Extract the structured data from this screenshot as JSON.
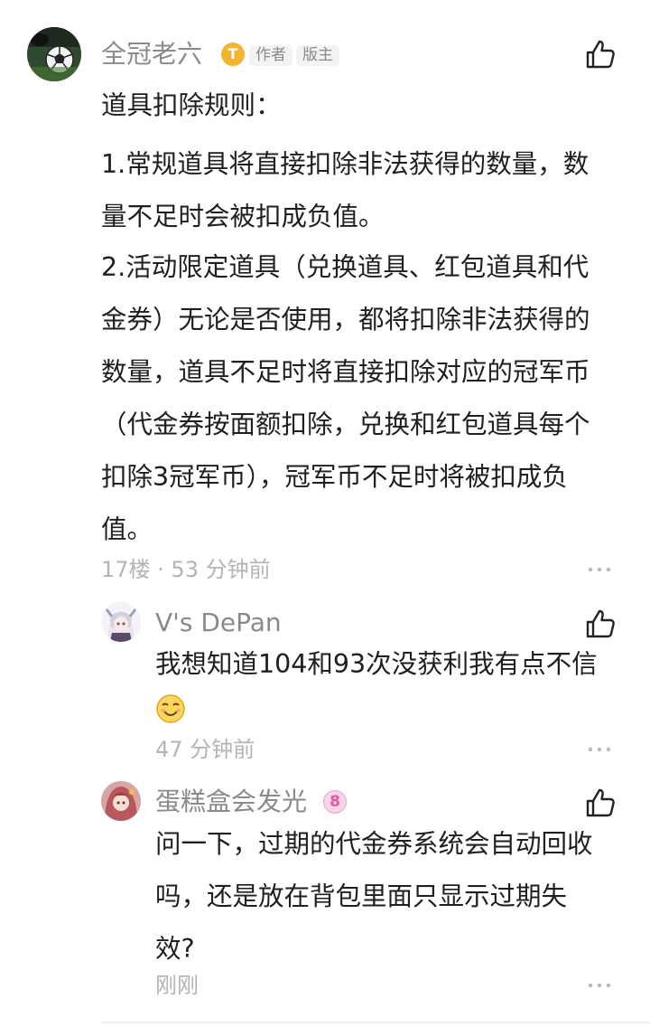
{
  "comments": [
    {
      "username": "全冠老六",
      "badge_letter": "T",
      "tags": [
        "作者",
        "版主"
      ],
      "lines": [
        "道具扣除规则：",
        "1.常规道具将直接扣除非法获得的数量，数",
        "量不足时会被扣成负值。",
        "2.活动限定道具（兑换道具、红包道具和代",
        "金券）无论是否使用，都将扣除非法获得的",
        "数量，道具不足时将直接扣除对应的冠军币",
        "（代金券按面额扣除，兑换和红包道具每个",
        "扣除3冠军币），冠军币不足时将被扣成负",
        "值。"
      ],
      "meta": "17楼 · 53 分钟前",
      "avatar_icon": "soccer-ball-icon"
    }
  ],
  "replies": [
    {
      "username": "V's DePan",
      "text": "我想知道104和93次没获利我有点不信",
      "emoji": "smiling-face-icon",
      "meta": "47 分钟前",
      "avatar_icon": "anime-avatar-icon"
    },
    {
      "username": "蛋糕盒会发光",
      "level": "8",
      "lines": [
        "问一下，过期的代金券系统会自动回收",
        "吗，还是放在背包里面只显示过期失",
        "效?"
      ],
      "meta": "刚刚",
      "avatar_icon": "anime-avatar-icon"
    }
  ],
  "colors": {
    "text": "#1f1f1f",
    "muted": "#8a8a8a",
    "meta": "#b4b4b4",
    "badge": "#f2b532"
  }
}
